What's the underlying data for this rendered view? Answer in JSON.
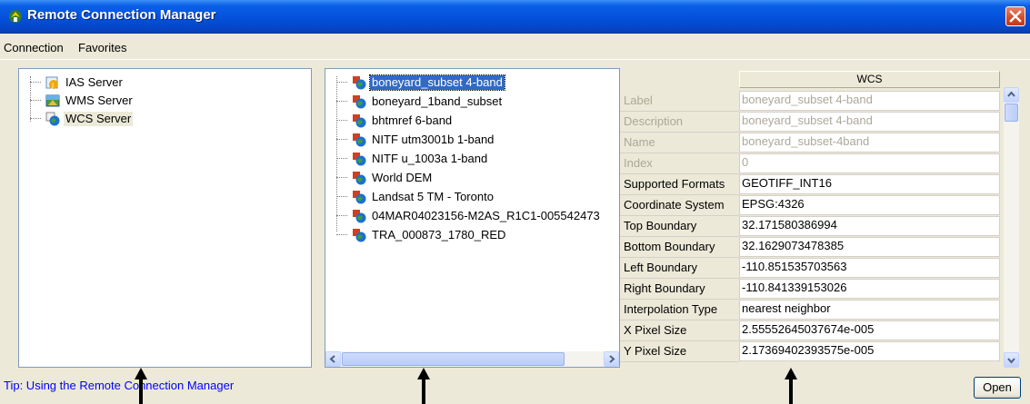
{
  "window": {
    "title": "Remote Connection Manager"
  },
  "menu": [
    "Connection",
    "Favorites"
  ],
  "servers": [
    {
      "label": "IAS Server",
      "icon": "ias-server-icon"
    },
    {
      "label": "WMS Server",
      "icon": "wms-server-icon"
    },
    {
      "label": "WCS Server",
      "icon": "wcs-server-icon",
      "selected": true
    }
  ],
  "coverages": [
    {
      "label": "boneyard_subset 4-band",
      "selected": true
    },
    {
      "label": "boneyard_1band_subset"
    },
    {
      "label": "bhtmref 6-band"
    },
    {
      "label": "NITF utm3001b 1-band"
    },
    {
      "label": "NITF u_1003a 1-band"
    },
    {
      "label": "World DEM"
    },
    {
      "label": "Landsat 5 TM - Toronto"
    },
    {
      "label": "04MAR04023156-M2AS_R1C1-005542473"
    },
    {
      "label": "TRA_000873_1780_RED"
    }
  ],
  "properties": {
    "header": "WCS",
    "rows": [
      {
        "name": "Label",
        "value": "boneyard_subset 4-band",
        "dim": true
      },
      {
        "name": "Description",
        "value": "boneyard_subset 4-band",
        "dim": true
      },
      {
        "name": "Name",
        "value": "boneyard_subset-4band",
        "dim": true
      },
      {
        "name": "Index",
        "value": "0",
        "dim": true
      },
      {
        "name": "Supported Formats",
        "value": "GEOTIFF_INT16"
      },
      {
        "name": "Coordinate System",
        "value": "EPSG:4326"
      },
      {
        "name": "Top Boundary",
        "value": "32.171580386994"
      },
      {
        "name": "Bottom Boundary",
        "value": "32.1629073478385"
      },
      {
        "name": "Left Boundary",
        "value": "-110.851535703563"
      },
      {
        "name": "Right Boundary",
        "value": "-110.841339153026"
      },
      {
        "name": "Interpolation Type",
        "value": "nearest neighbor"
      },
      {
        "name": "X Pixel Size",
        "value": "2.55552645037674e-005"
      },
      {
        "name": "Y Pixel Size",
        "value": "2.17369402393575e-005"
      }
    ]
  },
  "tip": "Tip: Using the Remote Connection Manager",
  "open_button": "Open"
}
